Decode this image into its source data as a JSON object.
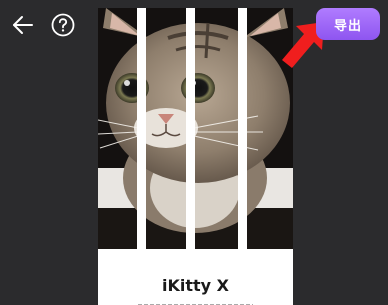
{
  "toolbar": {
    "back_icon": "arrow-left-icon",
    "help_icon": "question-circle-icon",
    "export_label": "导出",
    "export_color": "#9b64f8"
  },
  "annotation": {
    "arrow_icon": "red-arrow-icon",
    "arrow_color": "#f01e1e"
  },
  "canvas": {
    "image_description_icon": "cat-photo",
    "product_name": "iKitty X"
  }
}
